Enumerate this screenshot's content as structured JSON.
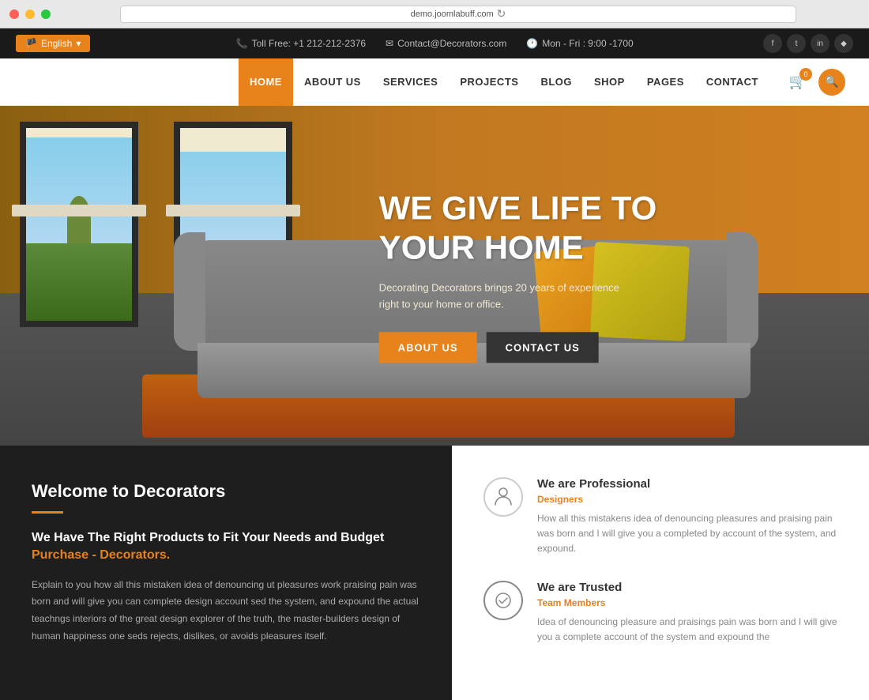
{
  "browser": {
    "url": "demo.joomlabuff.com",
    "dots": [
      "red",
      "yellow",
      "green"
    ]
  },
  "topbar": {
    "language": "English",
    "phone_icon": "📞",
    "phone": "Toll Free: +1 212-212-2376",
    "email_icon": "✉",
    "email": "Contact@Decorators.com",
    "clock_icon": "🕐",
    "hours": "Mon - Fri : 9:00 -1700",
    "social": [
      "f",
      "t",
      "in",
      "♦"
    ]
  },
  "nav": {
    "items": [
      {
        "label": "HOME",
        "active": true
      },
      {
        "label": "ABOUT US",
        "active": false
      },
      {
        "label": "SERVICES",
        "active": false
      },
      {
        "label": "PROJECTS",
        "active": false
      },
      {
        "label": "BLOG",
        "active": false
      },
      {
        "label": "SHOP",
        "active": false
      },
      {
        "label": "PAGES",
        "active": false
      },
      {
        "label": "CONTACT",
        "active": false
      }
    ],
    "cart_count": "0",
    "search_icon": "🔍"
  },
  "hero": {
    "title_line1": "WE GIVE LIFE TO",
    "title_line2": "YOUR HOME",
    "subtitle": "Decorating Decorators brings 20 years of experience right to your home or office.",
    "btn_about": "ABOUT US",
    "btn_contact": "CONTACT US"
  },
  "welcome": {
    "title": "Welcome to Decorators",
    "subtitle": "We Have The Right Products to Fit Your Needs and Budget",
    "link": "Purchase - Decorators.",
    "body": "Explain to you how all this mistaken idea of denouncing ut pleasures work praising pain was born and will give you can complete design account sed the system, and expound the actual teachngs interiors of the great design explorer of the truth, the master-builders design of human happiness one seds rejects, dislikes, or avoids pleasures itself.",
    "features": [
      {
        "icon": "person",
        "title": "We are Professional",
        "subtitle": "Designers",
        "text": "How all this mistakens idea of denouncing pleasures and praising pain was born and I will give you a completed by account of the system, and expound."
      },
      {
        "icon": "check",
        "title": "We are Trusted",
        "subtitle": "Team Members",
        "text": "Idea of denouncing pleasure and praisings pain was born and I will give you a complete account of the system and expound the"
      }
    ]
  },
  "colors": {
    "orange": "#e8821a",
    "dark": "#1e1e1e",
    "white": "#ffffff"
  }
}
